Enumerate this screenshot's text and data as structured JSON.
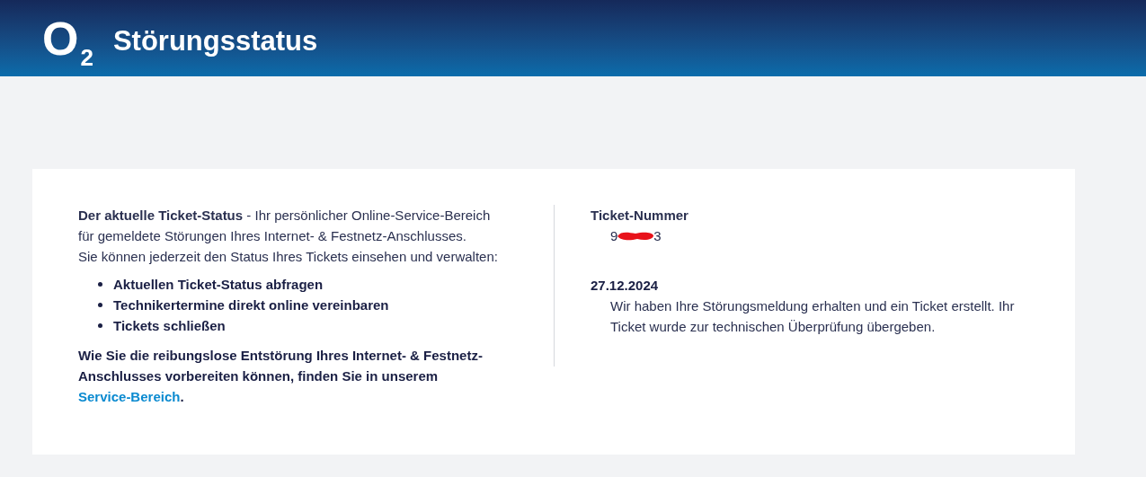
{
  "header": {
    "logo": {
      "letter": "O",
      "subscript": "2"
    },
    "title": "Störungsstatus"
  },
  "info": {
    "intro": [
      "**Der aktuelle Ticket-Status** - Ihr persönlicher Online-Service-Bereich für gemeldete Störungen Ihres Internet- & Festnetz-Anschlusses.",
      "Sie können jederzeit den Status Ihres Tickets einsehen und verwalten:"
    ],
    "features": [
      "Aktuellen Ticket-Status abfragen",
      "Technikertermine direkt online vereinbaren",
      "Tickets schließen"
    ],
    "closing": {
      "text": "Wie Sie die reibungslose Entstörung Ihres Internet- & Festnetz-Anschlusses vorbereiten können, finden Sie in unserem ",
      "link": "Service-Bereich",
      "suffix": "."
    }
  },
  "ticket": {
    "label": "Ticket-Nummer",
    "number_start": "9",
    "number_end": "3",
    "events": [
      {
        "date": "27.12.2024",
        "message": "Wir haben Ihre Störungsmeldung erhalten und ein Ticket erstellt. Ihr Ticket wurde zur technischen Überprüfung übergeben."
      }
    ]
  }
}
